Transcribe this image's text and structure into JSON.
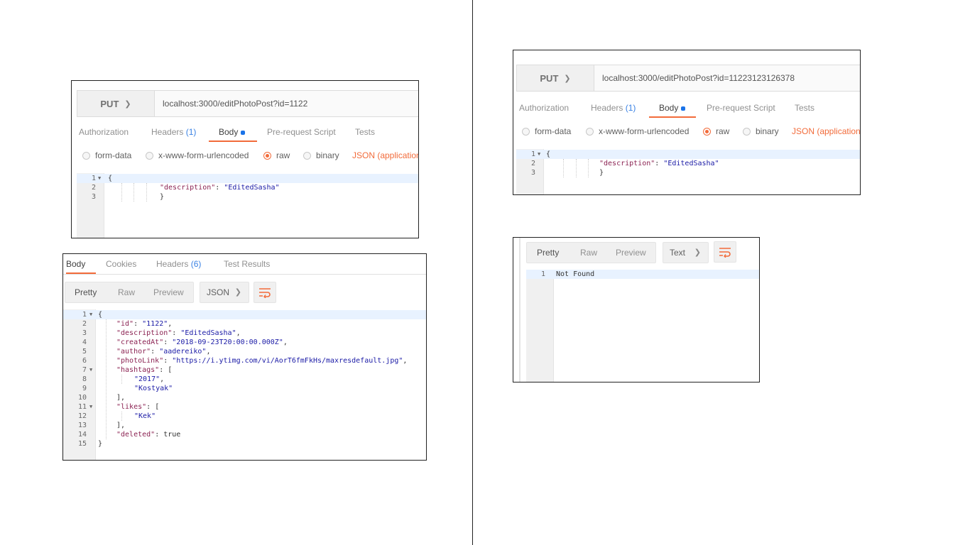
{
  "request_left": {
    "method": "PUT",
    "url": "localhost:3000/editPhotoPost?id=1122",
    "tabs": [
      "Authorization",
      "Headers",
      "Body",
      "Pre-request Script",
      "Tests"
    ],
    "headers_count": "(1)",
    "body_modes": [
      "form-data",
      "x-www-form-urlencoded",
      "raw",
      "binary"
    ],
    "content_type": "JSON (application/",
    "body_lines": [
      "1",
      "2",
      "3"
    ],
    "body_key": "\"description\"",
    "body_value": "\"EditedSasha\""
  },
  "request_right": {
    "method": "PUT",
    "url": "localhost:3000/editPhotoPost?id=11223123126378",
    "tabs": [
      "Authorization",
      "Headers",
      "Body",
      "Pre-request Script",
      "Tests"
    ],
    "headers_count": "(1)",
    "body_modes": [
      "form-data",
      "x-www-form-urlencoded",
      "raw",
      "binary"
    ],
    "content_type": "JSON (application/",
    "body_lines": [
      "1",
      "2",
      "3"
    ],
    "body_key": "\"description\"",
    "body_value": "\"EditedSasha\""
  },
  "response_left": {
    "tabs": [
      "Body",
      "Cookies",
      "Headers",
      "Test Results"
    ],
    "headers_count": "(6)",
    "views": [
      "Pretty",
      "Raw",
      "Preview"
    ],
    "format": "JSON",
    "lines": [
      "1",
      "2",
      "3",
      "4",
      "5",
      "6",
      "7",
      "8",
      "9",
      "10",
      "11",
      "12",
      "13",
      "14",
      "15"
    ],
    "json": {
      "id_key": "\"id\"",
      "id_val": "\"1122\"",
      "desc_key": "\"description\"",
      "desc_val": "\"EditedSasha\"",
      "created_key": "\"createdAt\"",
      "created_val": "\"2018-09-23T20:00:00.000Z\"",
      "author_key": "\"author\"",
      "author_val": "\"aadereiko\"",
      "photo_key": "\"photoLink\"",
      "photo_val": "\"https://i.ytimg.com/vi/AorT6fmFkHs/maxresdefault.jpg\"",
      "hashtags_key": "\"hashtags\"",
      "tag1": "\"2017\"",
      "tag2": "\"Kostyak\"",
      "likes_key": "\"likes\"",
      "like1": "\"Kek\"",
      "deleted_key": "\"deleted\"",
      "deleted_val": "true"
    }
  },
  "response_right": {
    "views": [
      "Pretty",
      "Raw",
      "Preview"
    ],
    "format": "Text",
    "lines": [
      "1"
    ],
    "text": "Not Found"
  }
}
